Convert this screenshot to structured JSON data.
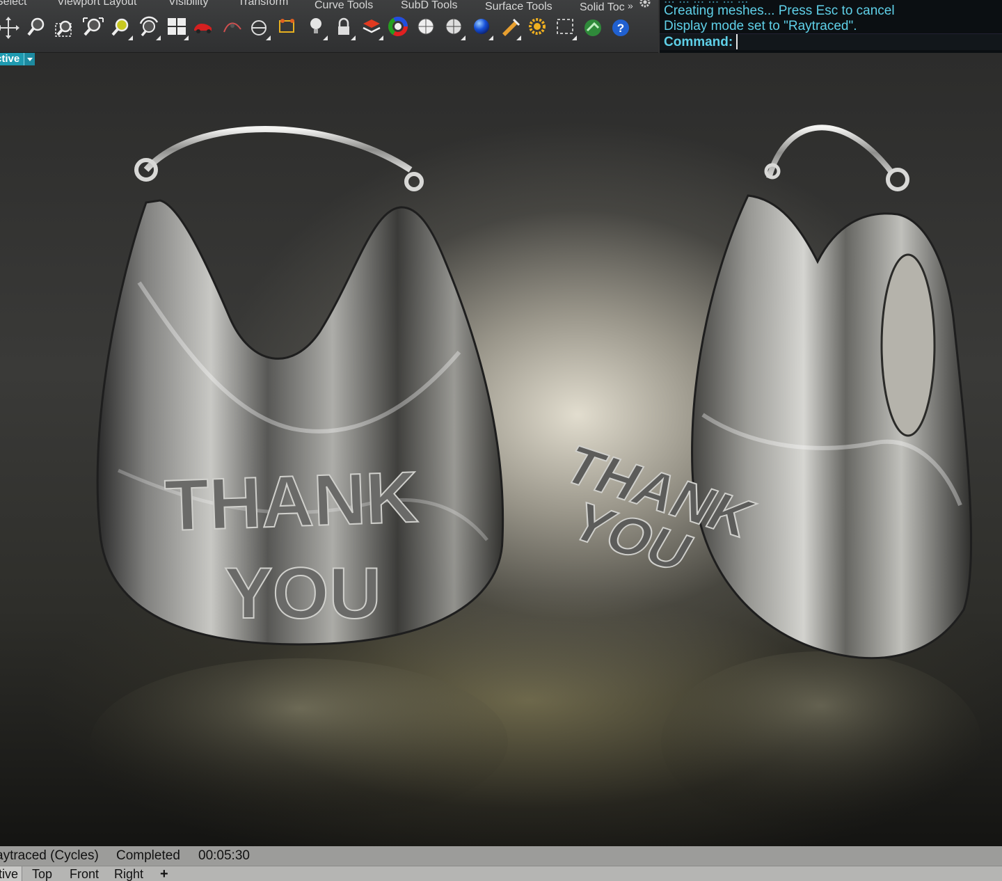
{
  "toolbar": {
    "tabs": [
      "Select",
      "Viewport Layout",
      "Visibility",
      "Transform",
      "Curve Tools",
      "SubD Tools",
      "Surface Tools",
      "Solid Toc"
    ],
    "overflow_label": "»",
    "icons": [
      "gumball-move-icon",
      "zoom-icon",
      "zoom-window-icon",
      "zoom-extents-icon",
      "zoom-selected-icon",
      "rotate-view-icon",
      "four-viewports-icon",
      "car-icon",
      "curve-edit-icon",
      "cplane-icon",
      "named-position-icon",
      "light-bulb-icon",
      "lock-icon",
      "layer-color-icon",
      "color-wheel-icon",
      "shaded-sphere-icon",
      "rendered-sphere-icon",
      "blue-sphere-icon",
      "pencil-icon",
      "sun-settings-icon",
      "selection-frame-icon",
      "render-globe-icon",
      "help-icon"
    ]
  },
  "command_pane": {
    "history": [
      "... ... ... ... ... ...",
      "Creating meshes... Press Esc to cancel",
      "Display mode set to \"Raytraced\"."
    ],
    "prompt_label": "Command:",
    "input_value": ""
  },
  "viewport": {
    "active_label": "ctive",
    "scene_text": {
      "left_bag": [
        "THANK",
        "YOU"
      ],
      "right_bag": [
        "THANK",
        "YOU"
      ]
    }
  },
  "status": {
    "mode": "aytraced (Cycles)",
    "state": "Completed",
    "time": "00:05:30"
  },
  "viewport_tabs": {
    "tabs": [
      "tive",
      "Top",
      "Front",
      "Right"
    ],
    "add_label": "+"
  },
  "colors": {
    "accent_cyan": "#5fd0e8",
    "viewport_label_bg": "#1f9ab0"
  }
}
